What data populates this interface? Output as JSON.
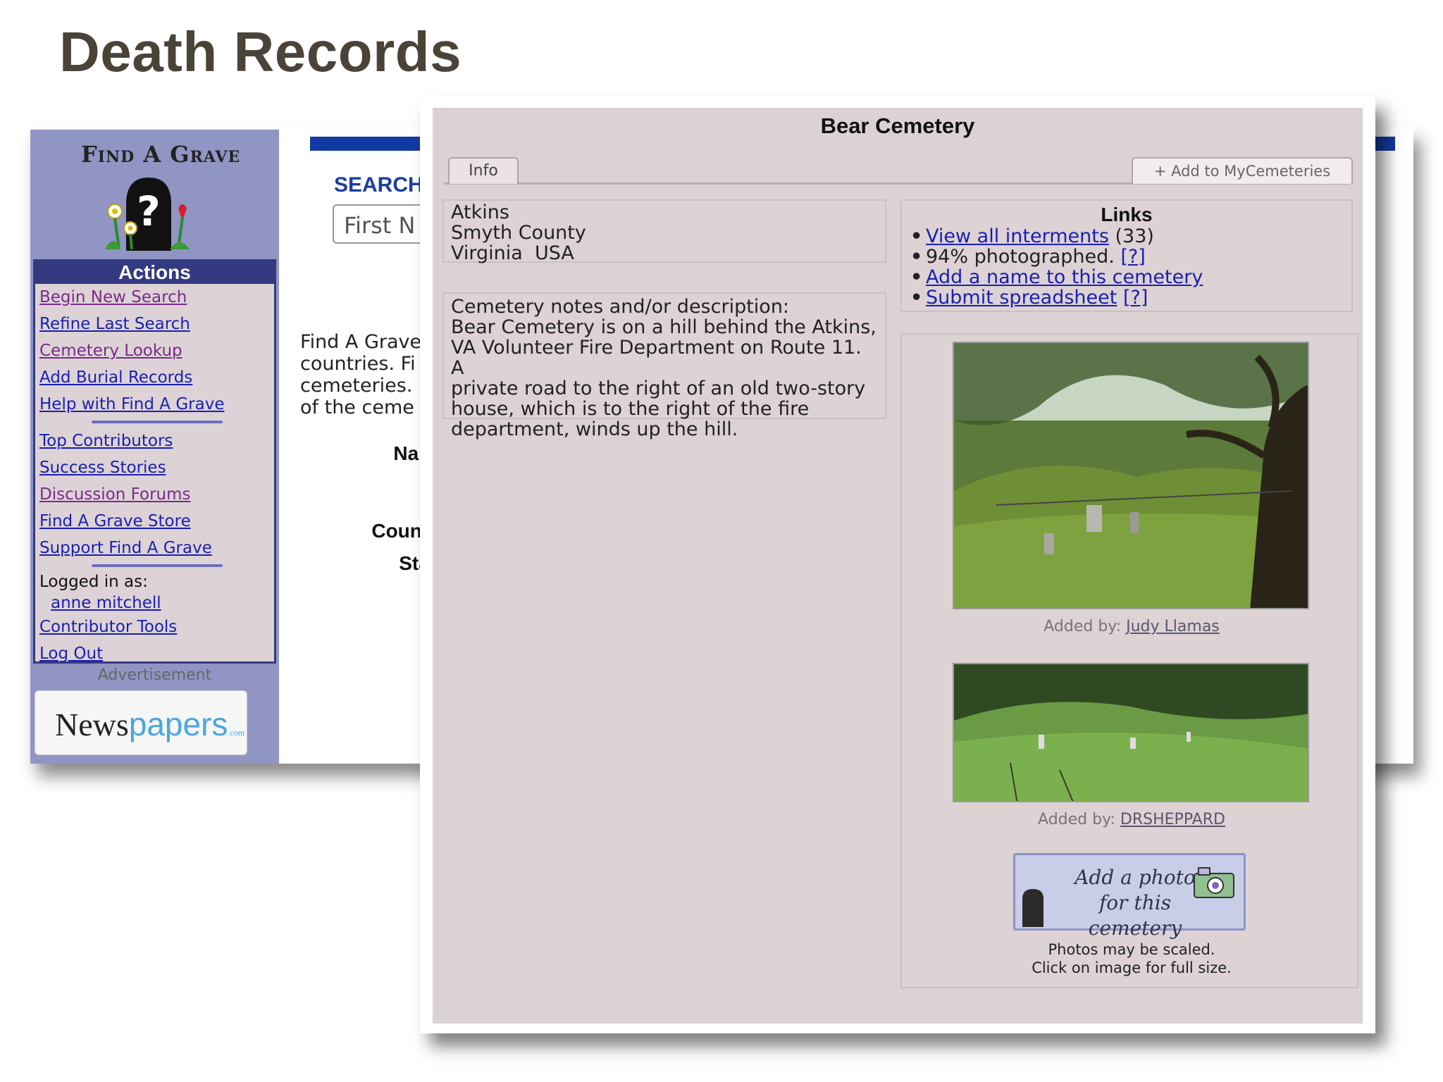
{
  "slide": {
    "title": "Death Records"
  },
  "site": {
    "logo": "Find A Grave",
    "actions_title": "Actions",
    "actions": [
      {
        "label": "Begin New Search",
        "visited": true
      },
      {
        "label": "Refine Last Search",
        "visited": false
      },
      {
        "label": "Cemetery Lookup",
        "visited": true
      },
      {
        "label": "Add Burial Records",
        "visited": false
      },
      {
        "label": "Help with Find A Grave",
        "visited": false
      }
    ],
    "community": [
      {
        "label": "Top Contributors",
        "visited": false
      },
      {
        "label": "Success Stories",
        "visited": false
      },
      {
        "label": "Discussion Forums",
        "visited": true
      },
      {
        "label": "Find A Grave Store",
        "visited": false
      },
      {
        "label": "Support Find A Grave",
        "visited": false
      }
    ],
    "logged_in_label": "Logged in as:",
    "username": "anne mitchell",
    "contributor_tools": "Contributor Tools",
    "logout": "Log Out",
    "ad_label": "Advertisement",
    "ad_brand_dark": "News",
    "ad_brand_light": "papers",
    "ad_brand_suffix": ".com",
    "search_heading": "SEARCH",
    "first_name_placeholder": "First N",
    "intro_lines": [
      "Find A Grave",
      "countries. Fi",
      "cemeteries.",
      "of the ceme"
    ],
    "form_labels": {
      "name": "Name:",
      "country": "Country:",
      "state": "State:"
    }
  },
  "cemetery": {
    "title": "Bear Cemetery",
    "tab_info": "Info",
    "tab_add": "+ Add to MyCemeteries",
    "location": [
      "Atkins",
      "Smyth County",
      "Virginia  USA"
    ],
    "description_label": "Cemetery notes and/or description:",
    "description_lines": [
      "Bear Cemetery is on a hill behind the Atkins,",
      "VA Volunteer Fire Department on Route 11. A",
      "private road to the right of an old two-story",
      "house, which is to the right of the fire",
      "department, winds up the hill."
    ],
    "links_title": "Links",
    "links": {
      "view_all": "View all interments",
      "view_all_count": "(33)",
      "photographed": "94% photographed.",
      "help_mark": "[?]",
      "add_name": "Add a name to this cemetery",
      "submit": "Submit spreadsheet",
      "submit_help": "[?]"
    },
    "photo1_caption_label": "Added by:",
    "photo1_caption_user": "Judy Llamas",
    "photo2_caption_label": "Added by:",
    "photo2_caption_user": "DRSHEPPARD",
    "add_photo_line1": "Add a photo",
    "add_photo_line2": "for this cemetery",
    "note_line1": "Photos may be scaled.",
    "note_line2": "Click on image for full size."
  }
}
